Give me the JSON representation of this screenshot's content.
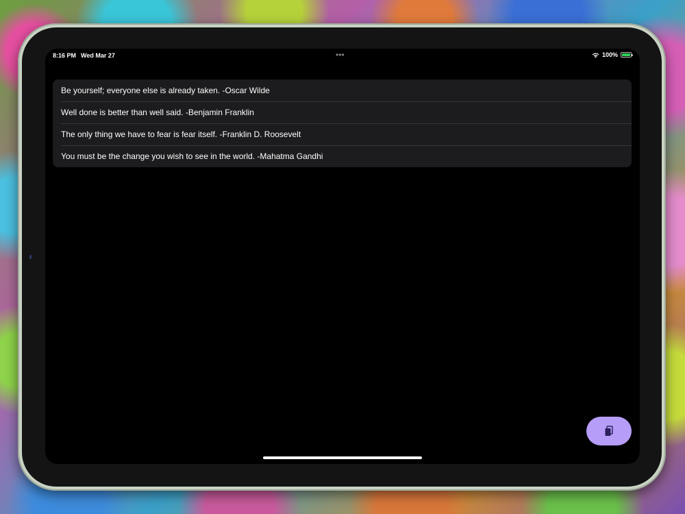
{
  "status_bar": {
    "time": "8:16 PM",
    "date": "Wed Mar 27",
    "battery_percent": "100%",
    "icons": [
      "wifi-icon",
      "battery-icon"
    ]
  },
  "quotes": [
    "Be yourself; everyone else is already taken. -Oscar Wilde",
    "Well done is better than well said. -Benjamin Franklin",
    "The only thing we have to fear is fear itself. -Franklin D. Roosevelt",
    "You must be the change you wish to see in the world. -Mahatma Gandhi"
  ],
  "fab": {
    "icon": "copy-icon",
    "color": "#b69df8"
  },
  "colors": {
    "screen_background": "#000000",
    "list_background": "#1c1c1e",
    "separator": "#38383a",
    "text": "#ffffff",
    "battery": "#30d158"
  }
}
